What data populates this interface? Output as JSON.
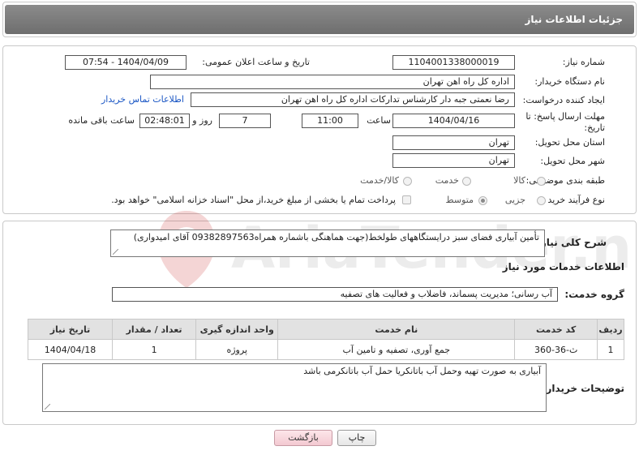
{
  "header": {
    "title": "جزئیات اطلاعات نیاز"
  },
  "fields": {
    "need_number_label": "شماره نیاز:",
    "need_number": "1104001338000019",
    "announce_label": "تاریخ و ساعت اعلان عمومی:",
    "announce_value": "1404/04/09 - 07:54",
    "buyer_org_label": "نام دستگاه خریدار:",
    "buyer_org": "اداره کل راه اهن تهران",
    "creator_label": "ایجاد کننده درخواست:",
    "creator": "رضا نعمتی جبه دار کارشناس تدارکات اداره کل راه اهن تهران",
    "contact_link": "اطلاعات تماس خریدار",
    "deadline_label_1": "مهلت ارسال پاسخ: تا",
    "deadline_label_2": "تاریخ:",
    "deadline_date": "1404/04/16",
    "time_label": "ساعت",
    "deadline_time": "11:00",
    "days_value": "7",
    "days_label": "روز و",
    "remaining_time": "02:48:01",
    "remaining_label": "ساعت باقی مانده",
    "province_label": "استان محل تحویل:",
    "province": "تهران",
    "city_label": "شهر محل تحویل:",
    "city": "تهران",
    "category_label": "طبقه بندی موضوعی:",
    "category_options": [
      "کالا",
      "خدمت",
      "کالا/خدمت"
    ],
    "process_label": "نوع فرآیند خرید :",
    "process_options": [
      "جزیی",
      "متوسط"
    ],
    "payment_note": "پرداخت تمام یا بخشی از مبلغ خرید،از محل \"اسناد خزانه اسلامی\" خواهد بود."
  },
  "summary": {
    "label": "شرح کلی نیاز:",
    "text": "تأمین آبیاری فضای سبز درایستگاههای طولخط(جهت هماهنگی باشماره همراه09382897563 آقای امیدواری)"
  },
  "services": {
    "section_title": "اطلاعات خدمات مورد نیاز",
    "group_label": "گروه خدمت:",
    "group_value": "آب رسانی؛ مدیریت پسماند، فاضلاب و فعالیت های تصفیه",
    "columns": [
      "ردیف",
      "کد خدمت",
      "نام خدمت",
      "واحد اندازه گیری",
      "تعداد / مقدار",
      "تاریخ نیاز"
    ],
    "rows": [
      [
        "1",
        "ث-36-360",
        "جمع آوری، تصفیه و تامین آب",
        "پروژه",
        "1",
        "1404/04/18"
      ]
    ]
  },
  "buyer_notes": {
    "label": "توضیحات خریدار:",
    "text": "آبیاری به صورت تهیه وحمل آب باتانکریا حمل آب باتانکرمی باشد"
  },
  "buttons": {
    "print": "چاپ",
    "back": "بازگشت"
  },
  "watermark": {
    "text": "AriaTender.neT"
  },
  "colors": {
    "header_bg": "#7a7a7a",
    "link": "#1a56c4",
    "back_button": "#f3c9d1"
  }
}
